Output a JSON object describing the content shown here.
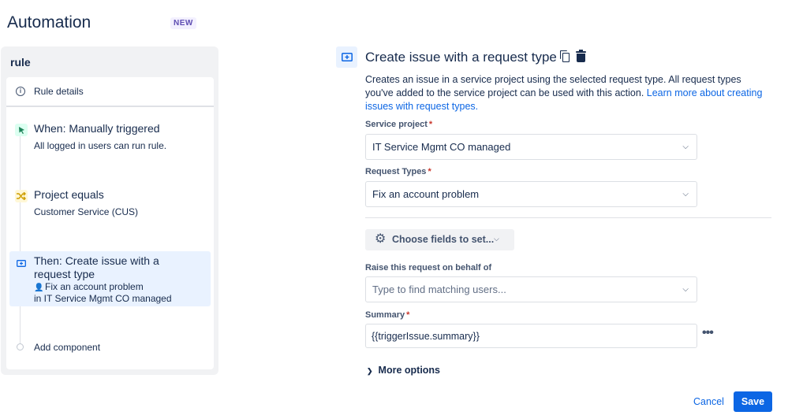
{
  "header": {
    "title": "Automation",
    "badge": "NEW"
  },
  "rule": {
    "title": "rule",
    "details_label": "Rule details",
    "trigger": {
      "title": "When: Manually triggered",
      "subtitle": "All logged in users can run rule."
    },
    "condition": {
      "title": "Project equals",
      "subtitle": "Customer Service (CUS)"
    },
    "action": {
      "title": "Then: Create issue with a request type",
      "line1": "Fix an account problem",
      "line2": "in IT Service Mgmt CO managed"
    },
    "add_component_label": "Add component"
  },
  "config": {
    "title": "Create issue with a request type",
    "description": "Creates an issue in a service project using the selected request type. All request types you've added to the service project can be used with this action.",
    "learn_more_link": "Learn more about creating issues with request types.",
    "service_project": {
      "label": "Service project",
      "required_marker": "*",
      "value": "IT Service Mgmt CO managed"
    },
    "request_types": {
      "label": "Request Types",
      "required_marker": "*",
      "value": "Fix an account problem"
    },
    "choose_fields_label": "Choose fields to set...",
    "behalf": {
      "label": "Raise this request on behalf of",
      "placeholder": "Type to find matching users..."
    },
    "summary": {
      "label": "Summary",
      "required_marker": "*",
      "value": "{{triggerIssue.summary}}"
    },
    "more_options_label": "More options",
    "cancel_label": "Cancel",
    "save_label": "Save"
  },
  "colors": {
    "accent": "#0c66e4",
    "selected_bg": "#e9f2ff",
    "required": "#c9372c"
  },
  "icons": {
    "trigger": "cursor-click-icon",
    "condition": "shuffle-icon",
    "action": "create-issue-icon",
    "settings": "gear-icon"
  }
}
